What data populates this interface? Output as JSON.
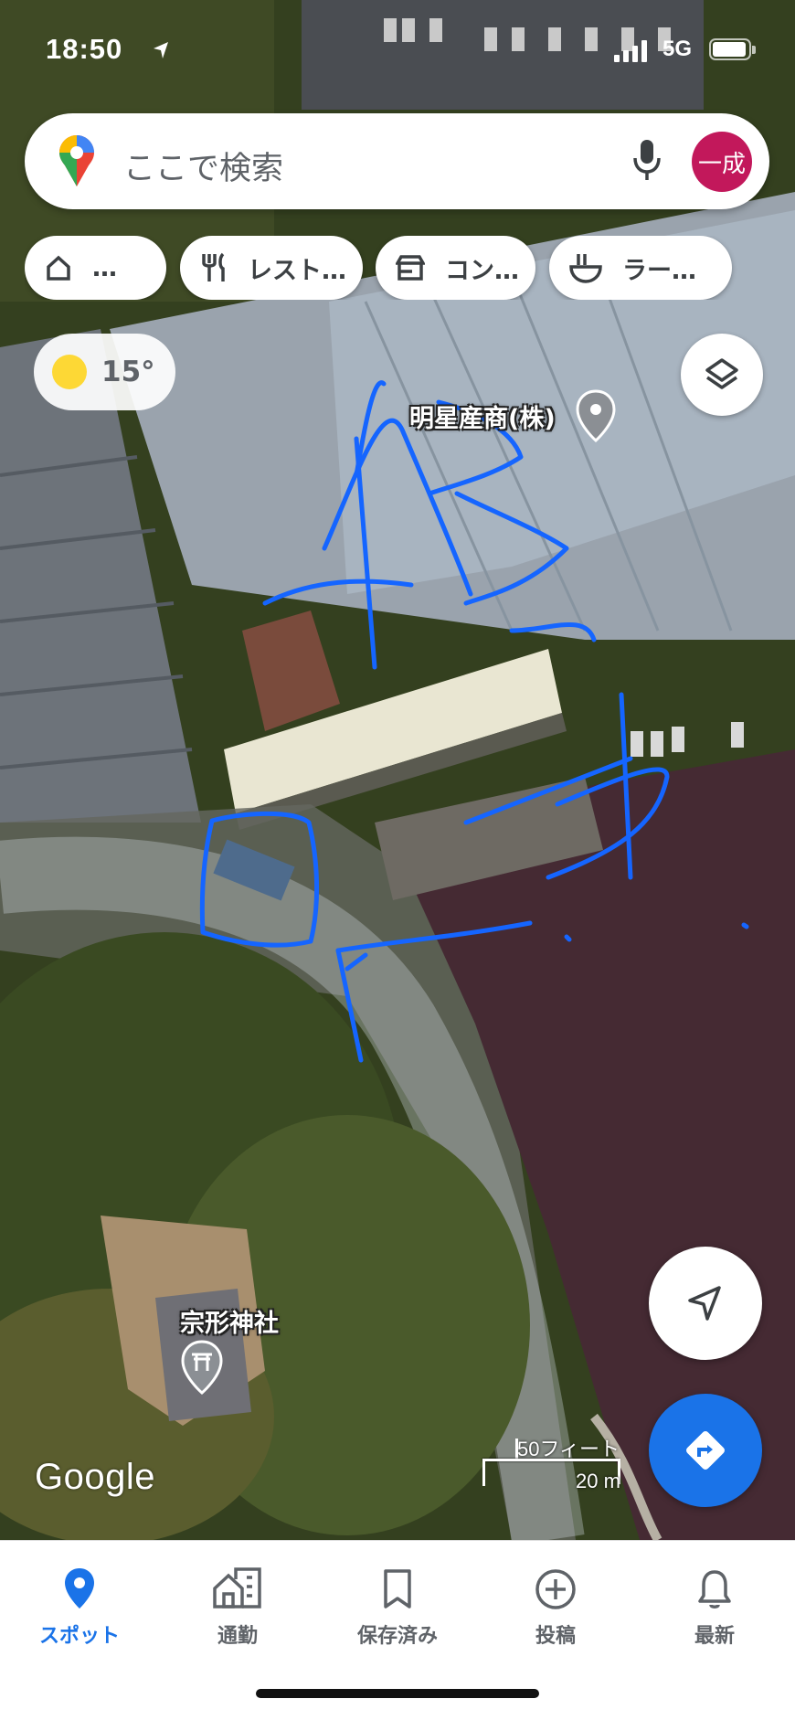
{
  "status_bar": {
    "time": "18:50",
    "network": "5G"
  },
  "search": {
    "placeholder": "ここで検索",
    "avatar_text": "一成"
  },
  "chips": [
    {
      "icon": "home-icon",
      "label": "…"
    },
    {
      "icon": "restaurant-icon",
      "label": "レスト…"
    },
    {
      "icon": "store-icon",
      "label": "コン…"
    },
    {
      "icon": "ramen-icon",
      "label": "ラー…"
    }
  ],
  "weather": {
    "temp": "15°"
  },
  "map": {
    "poi_company": "明星産商(株)",
    "poi_shrine": "宗形神社",
    "attribution": "Google",
    "scale_imperial": "50フィート",
    "scale_metric": "20 m",
    "handwriting_color": "#1565ff"
  },
  "bottom_nav": [
    {
      "icon": "explore-pin-icon",
      "label": "スポット",
      "active": true
    },
    {
      "icon": "commute-icon",
      "label": "通勤",
      "active": false
    },
    {
      "icon": "saved-bookmark-icon",
      "label": "保存済み",
      "active": false
    },
    {
      "icon": "contribute-plus-icon",
      "label": "投稿",
      "active": false
    },
    {
      "icon": "updates-bell-icon",
      "label": "最新",
      "active": false
    }
  ],
  "colors": {
    "accent": "#1a73e8",
    "avatar_bg": "#c2185b"
  }
}
